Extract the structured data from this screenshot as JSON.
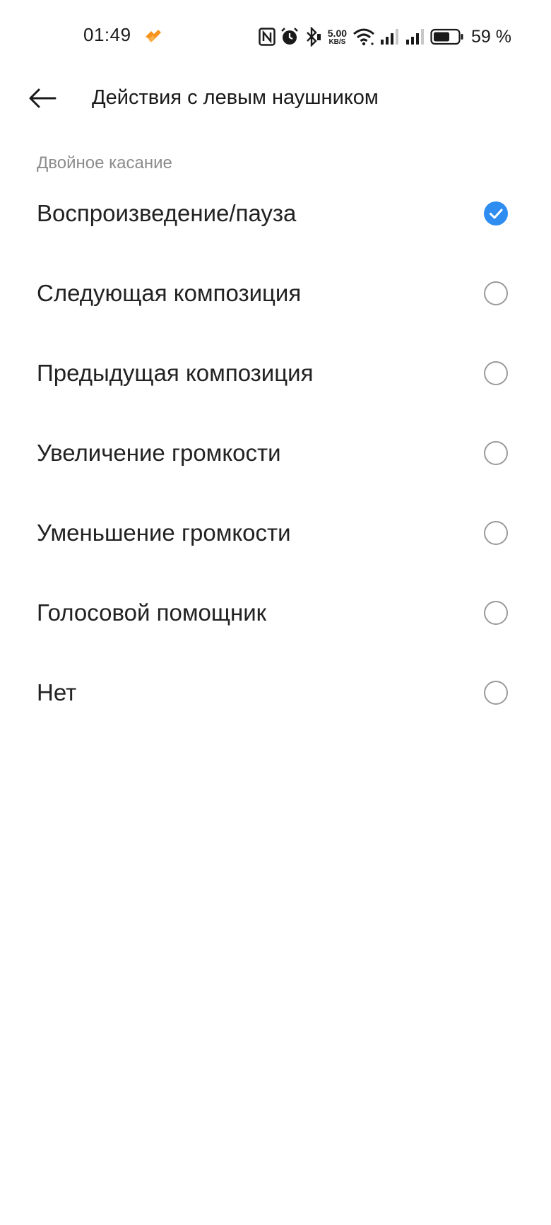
{
  "status_bar": {
    "time": "01:49",
    "net_speed_value": "5.00",
    "net_speed_unit": "KB/S",
    "battery_percent": "59 %",
    "icons": [
      "app-notification-icon",
      "nfc-icon",
      "alarm-icon",
      "bluetooth-icon",
      "wifi-icon",
      "signal-sim1-icon",
      "signal-sim2-icon",
      "battery-icon"
    ],
    "app_icon_color": "#f7941d"
  },
  "header": {
    "title": "Действия с левым наушником",
    "back_icon": "arrow-left-icon"
  },
  "section": {
    "label": "Двойное касание"
  },
  "options": [
    {
      "label": "Воспроизведение/пауза",
      "selected": true
    },
    {
      "label": "Следующая композиция",
      "selected": false
    },
    {
      "label": "Предыдущая композиция",
      "selected": false
    },
    {
      "label": "Увеличение громкости",
      "selected": false
    },
    {
      "label": "Уменьшение громкости",
      "selected": false
    },
    {
      "label": "Голосовой помощник",
      "selected": false
    },
    {
      "label": "Нет",
      "selected": false
    }
  ],
  "colors": {
    "accent": "#2f8cf0",
    "radio_border": "#9a9a9a",
    "section_label": "#8c8c8c"
  }
}
